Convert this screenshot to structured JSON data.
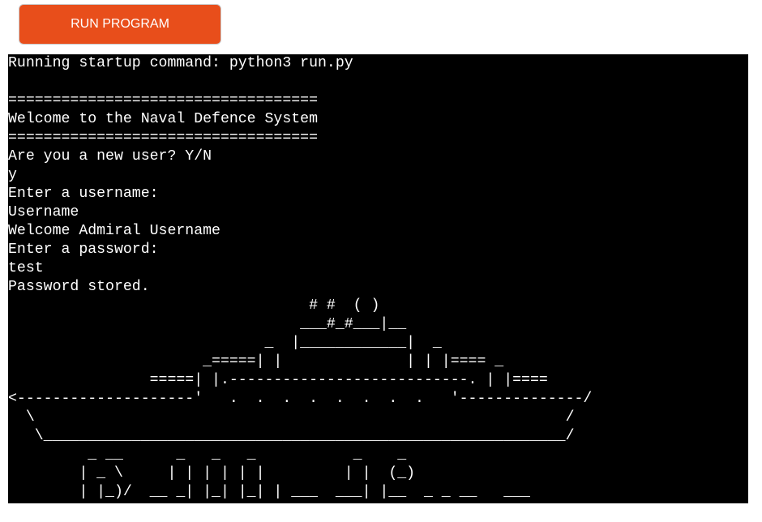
{
  "toolbar": {
    "run_label": "RUN PROGRAM"
  },
  "colors": {
    "button": "#e84e1b",
    "terminal_bg": "#000000",
    "terminal_fg": "#ffffff"
  },
  "terminal": {
    "lines": [
      "Running startup command: python3 run.py",
      "",
      "===================================",
      "Welcome to the Naval Defence System",
      "===================================",
      "Are you a new user? Y/N",
      "y",
      "Enter a username:",
      "Username",
      "Welcome Admiral Username",
      "Enter a password:",
      "test",
      "Password stored.",
      "                                  # #  ( )",
      "                                 ___#_#___|__",
      "                             _  |____________|  _",
      "                      _=====| |              | | |==== _",
      "                =====| |.---------------------------. | |====",
      "<--------------------'   .  .  .  .  .  .  .  .   '--------------/",
      "  \\                                                            /",
      "   \\___________________________________________________________/",
      "         _ __      _   _   _           _    _",
      "        | _ \\     | | | | | |         | |  (_)",
      "        | |_)/  __ _| |_| |_| | ___  ___| |__  _ _ __   ___"
    ]
  }
}
